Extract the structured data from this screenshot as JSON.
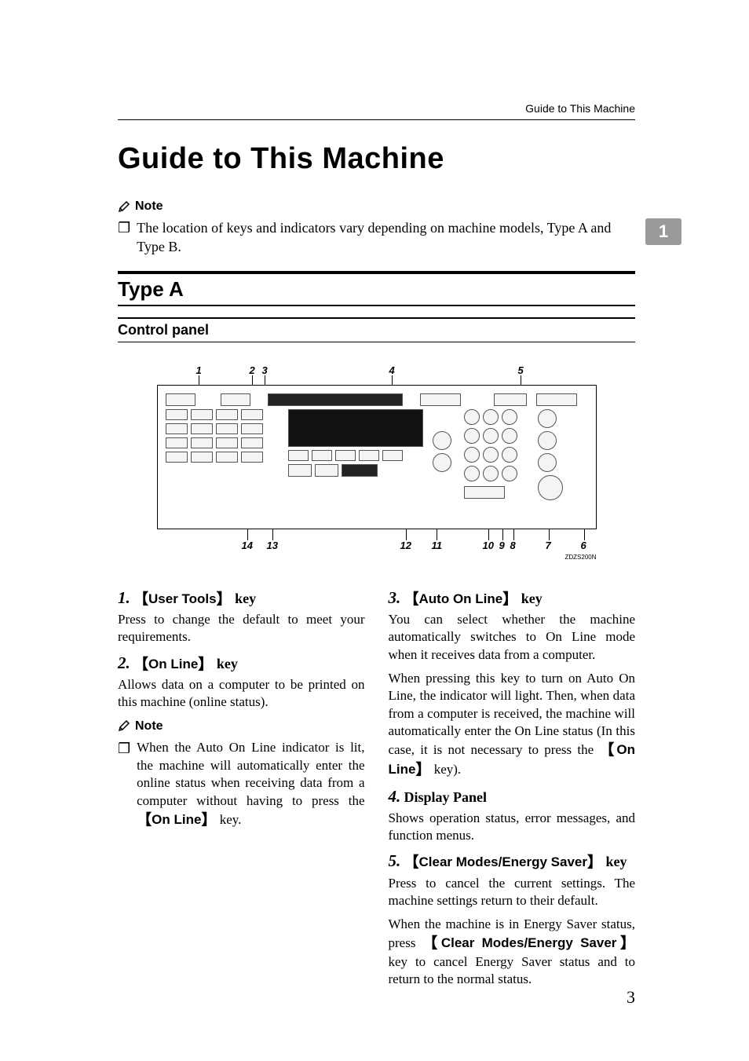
{
  "running_head": "Guide to This Machine",
  "title": "Guide to This Machine",
  "intro_note": {
    "label": "Note",
    "text": "The location of keys and indicators vary depending on machine models, Type A and Type B."
  },
  "section": "Type A",
  "subsection": "Control panel",
  "diagram": {
    "top_callouts": [
      "1",
      "2",
      "3",
      "4",
      "5"
    ],
    "bottom_callouts": [
      "14",
      "13",
      "12",
      "11",
      "10",
      "9",
      "8",
      "7",
      "6"
    ],
    "ref": "ZDZS200N"
  },
  "side_tab": "1",
  "left_col": {
    "i1": {
      "num": "1.",
      "key": "User Tools",
      "tail": " key",
      "body": "Press to change the default to meet your requirements."
    },
    "i2": {
      "num": "2.",
      "key": "On Line",
      "tail": " key",
      "body": "Allows data on a computer to be printed on this machine (online status)."
    },
    "note": {
      "label": "Note",
      "body_a": "When the Auto On Line indicator is lit, the machine will automatically enter the online status when receiving data from a computer without having to press the ",
      "body_key": "On Line",
      "body_b": " key."
    }
  },
  "right_col": {
    "i3": {
      "num": "3.",
      "key": "Auto On Line",
      "tail": " key",
      "p1": "You can select whether the machine automatically switches to On Line mode when it receives data from a computer.",
      "p2a": "When pressing this key to turn on Auto On Line, the indicator will light. Then, when data from a computer is received, the machine will automatically enter the On Line status (In this case, it is not necessary to press the ",
      "p2key": "On Line",
      "p2b": " key)."
    },
    "i4": {
      "num": "4.",
      "title": "Display Panel",
      "body": "Shows operation status, error messages, and function menus."
    },
    "i5": {
      "num": "5.",
      "key": "Clear Modes/Energy Saver",
      "tail": " key",
      "p1": "Press to cancel the current settings. The machine settings return to their default.",
      "p2a": "When the machine is in Energy Saver status, press ",
      "p2key": "Clear Modes/Energy Saver",
      "p2b": " key to cancel Energy Saver status and to return to the normal status."
    }
  },
  "page_number": "3"
}
